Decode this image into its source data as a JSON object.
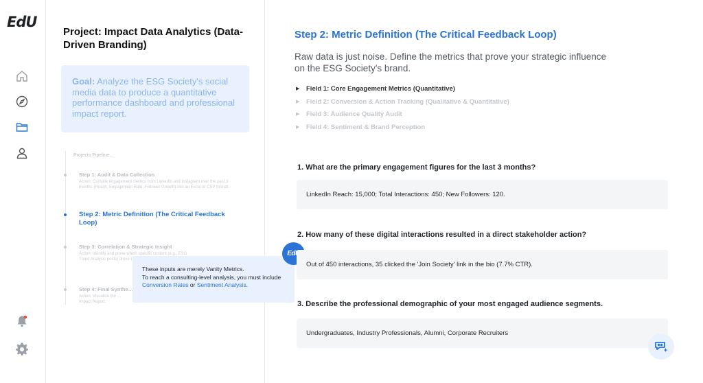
{
  "app": {
    "logo": "EdU"
  },
  "rail": {
    "icons": [
      "home-icon",
      "compass-icon",
      "folder-icon",
      "user-icon",
      "bell-icon",
      "gear-icon"
    ],
    "notification_color": "#e5484d"
  },
  "project": {
    "title": "Project: Impact Data Analytics (Data-Driven Branding)",
    "goal_label": "Goal:",
    "goal_text": " Analyze the ESG Society's social media data to produce a quantitative performance dashboard and professional impact report."
  },
  "pipeline": {
    "heading": "Projects Pipeline...",
    "steps": [
      {
        "title": "Step 1: Audit & Data Collection",
        "desc": "Action: Compile engagement metrics from LinkedIn and Instagram over the past 3 months (Reach, Engagement Rate, Follower Growth) into an Excel or CSV format."
      },
      {
        "title": "Step 2: Metric Definition (The Critical Feedback Loop)",
        "desc": ""
      },
      {
        "title": "Step 3: Correlation & Strategic Insight",
        "desc": "Action: Identify and prove which specific content (e.g., ESG Trend Analysis posts) drove t… audience."
      },
      {
        "title": "Step 4: Final Synthe…",
        "desc": "Action: Visualize the … Impact Report."
      }
    ]
  },
  "tooltip": {
    "badge": "EdU",
    "line1": "These inputs are merely Vanity Metrics.",
    "line2": "To reach a consulting-level analysis, you must include ",
    "link1": "Conversion Rates",
    "or": " or ",
    "link2": "Sentiment Analysis",
    "end": "."
  },
  "main": {
    "title": "Step 2: Metric Definition (The Critical Feedback Loop)",
    "lede": "Raw data is just noise. Define the metrics that prove your strategic influence on the ESG Society's brand.",
    "fields": [
      "Field 1: Core Engagement Metrics (Quantitative)",
      "Field 2: Conversion & Action Tracking (Qualitative & Quantitative)",
      "Field 3: Audience Quality Audit",
      "Field 4: Sentiment & Brand Perception"
    ],
    "questions": [
      {
        "q": "1. What are the primary engagement figures for the last 3 months?",
        "a": "LinkedIn Reach: 15,000; Total Interactions: 450; New Followers: 120."
      },
      {
        "q": "2. How many of these digital interactions resulted in a direct stakeholder action?",
        "a": "Out of 450 interactions, 35 clicked the 'Join Society' link in the bio (7.7% CTR)."
      },
      {
        "q": "3. Describe the professional demographic of your most engaged audience segments.",
        "a": "Undergraduates, Industry Professionals, Alumni, Corporate Recruiters"
      }
    ]
  },
  "colors": {
    "accent": "#2a74d8",
    "goal_bg": "#e8f1fd",
    "answer_bg": "#f4f5f6"
  }
}
